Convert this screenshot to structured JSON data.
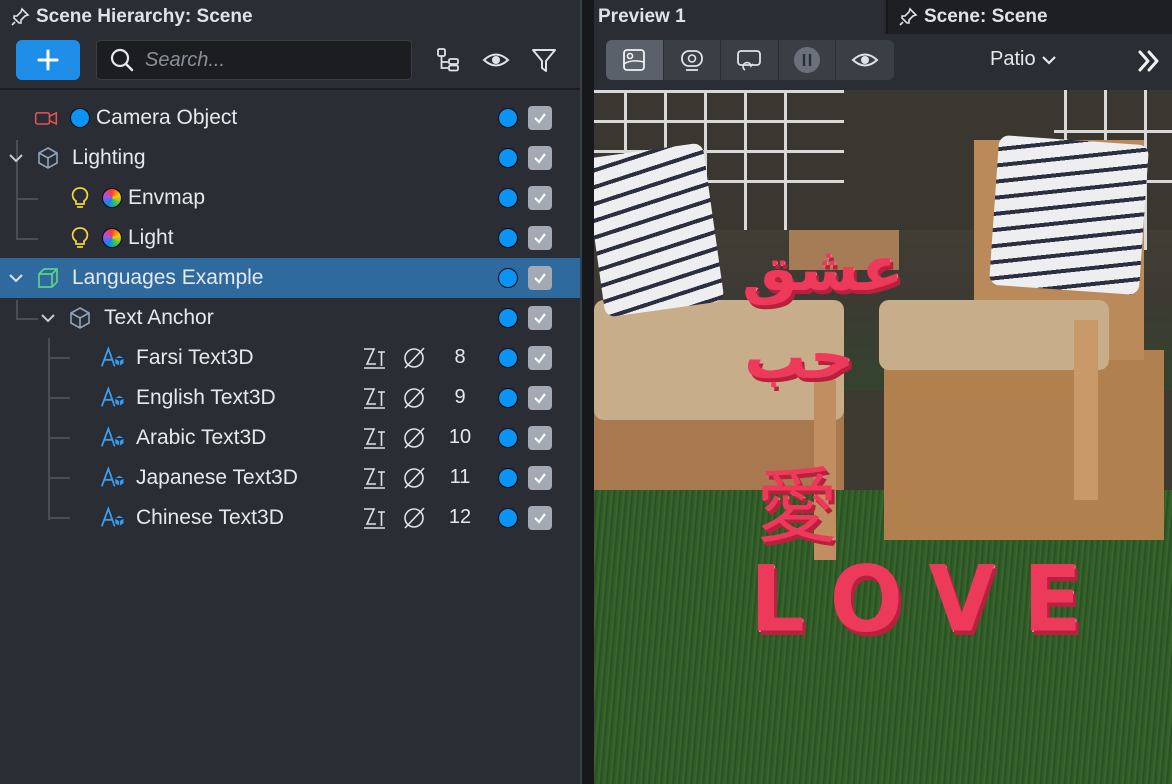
{
  "left_panel": {
    "title": "Scene Hierarchy: Scene",
    "search_placeholder": "Search...",
    "items": [
      {
        "name": "Camera Object",
        "icon": "camera-icon"
      },
      {
        "name": "Lighting",
        "icon": "cube-outline-icon"
      },
      {
        "name": "Envmap",
        "icon": "light-bulb-icon"
      },
      {
        "name": "Light",
        "icon": "light-bulb-icon"
      },
      {
        "name": "Languages Example",
        "icon": "cube-green-icon"
      },
      {
        "name": "Text Anchor",
        "icon": "cube-outline-icon"
      },
      {
        "name": "Farsi Text3D",
        "icon": "text3d-icon",
        "layer": "8"
      },
      {
        "name": "English Text3D",
        "icon": "text3d-icon",
        "layer": "9"
      },
      {
        "name": "Arabic Text3D",
        "icon": "text3d-icon",
        "layer": "10"
      },
      {
        "name": "Japanese Text3D",
        "icon": "text3d-icon",
        "layer": "11"
      },
      {
        "name": "Chinese Text3D",
        "icon": "text3d-icon",
        "layer": "12"
      }
    ]
  },
  "right_panel": {
    "tab_preview": "Preview 1",
    "tab_scene": "Scene: Scene",
    "environment": "Patio",
    "ar_text": {
      "farsi": "عشق",
      "arabic": "حب",
      "cjk": "愛",
      "english": "LOVE"
    }
  },
  "colors": {
    "accent": "#1e8ee8",
    "selection": "#2e6a9e",
    "visibility_dot": "#0b93f6",
    "ar_text": "#ee3a5a"
  }
}
